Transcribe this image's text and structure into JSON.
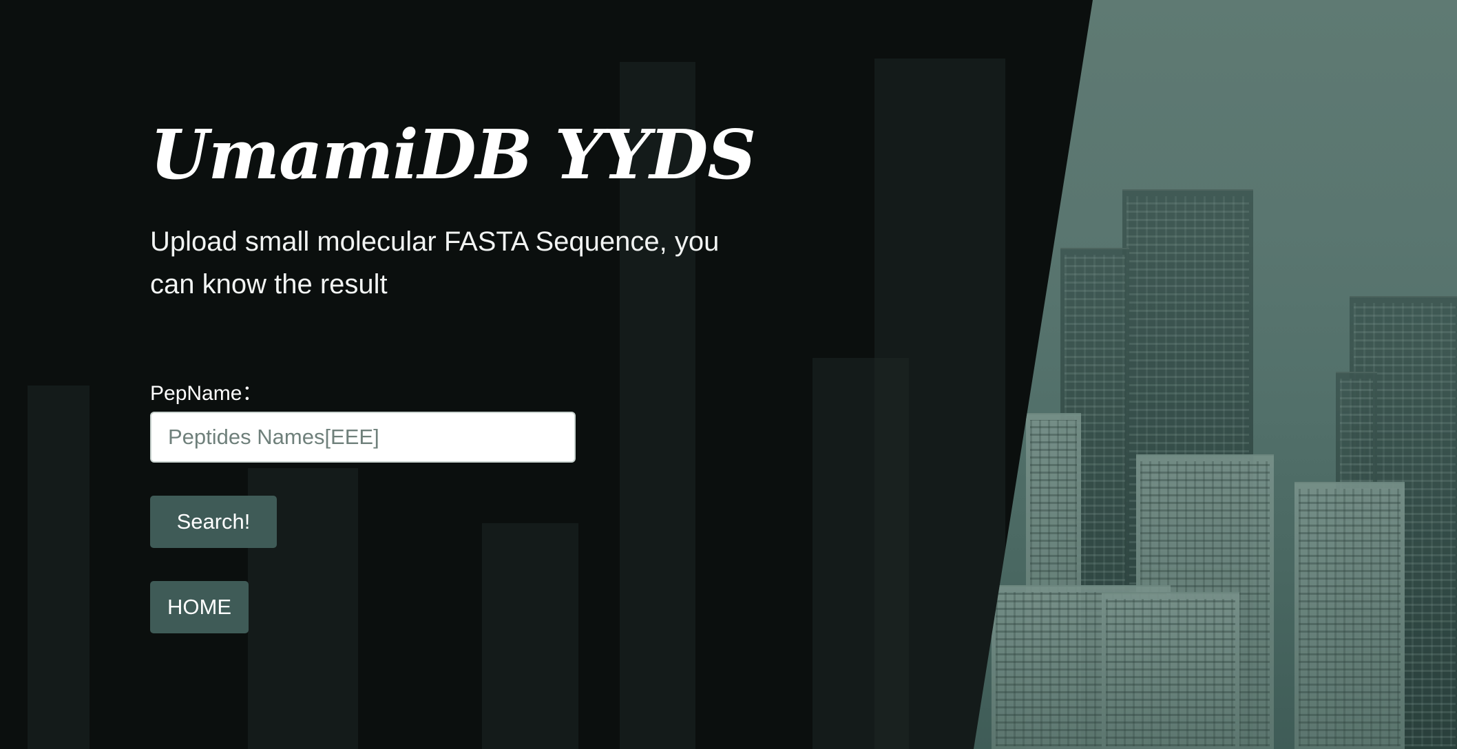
{
  "hero": {
    "title": "UmamiDB YYDS",
    "subtitle": "Upload small molecular FASTA Sequence, you can know the result"
  },
  "form": {
    "pep_label": "PepName：",
    "pep_placeholder": "Peptides Names[EEE]",
    "pep_value": "",
    "search_button": "Search!",
    "home_button": "HOME"
  },
  "colors": {
    "background": "#0b0f0e",
    "button": "#3f5b57",
    "panel": "#5a7670"
  }
}
